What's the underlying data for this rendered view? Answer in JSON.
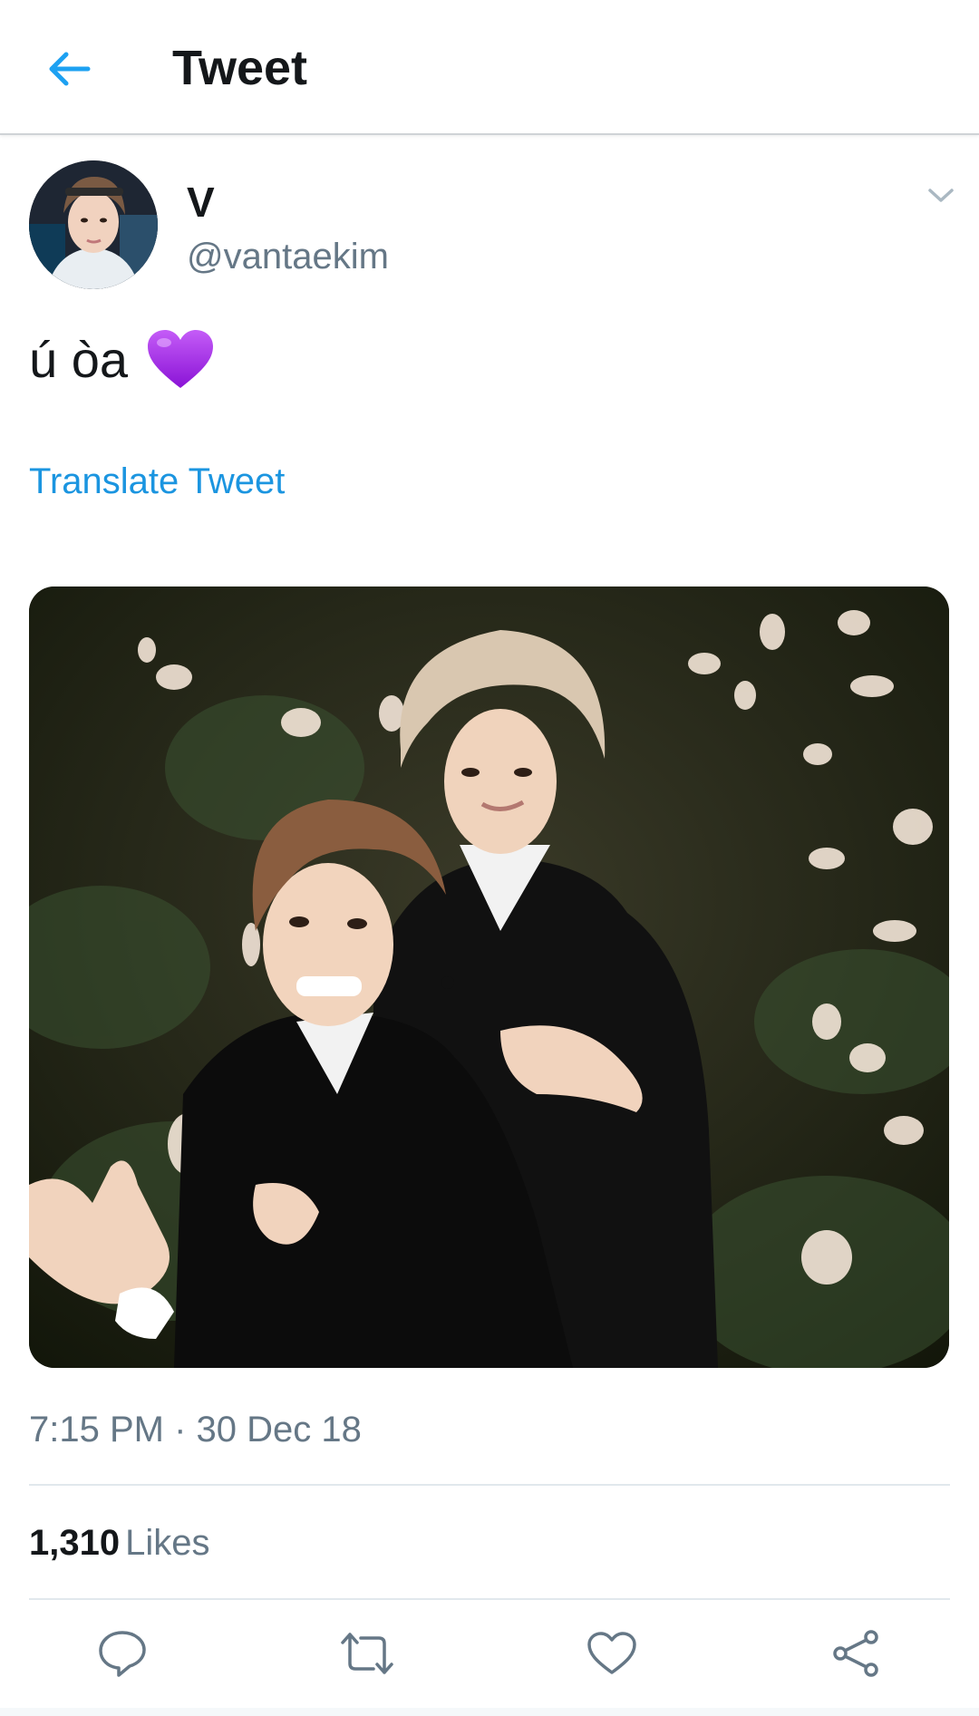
{
  "header": {
    "back_icon": "arrow-left-icon",
    "title": "Tweet"
  },
  "tweet": {
    "author": {
      "display_name": "V",
      "handle": "@vantaekim"
    },
    "text": "ú òa",
    "emoji": "purple-heart",
    "translate_label": "Translate Tweet",
    "timestamp": "7:15 PM · 30 Dec 18",
    "likes": {
      "count": "1,310",
      "label": "Likes"
    }
  },
  "actions": [
    {
      "name": "reply",
      "icon": "reply-icon"
    },
    {
      "name": "retweet",
      "icon": "retweet-icon"
    },
    {
      "name": "like",
      "icon": "heart-icon"
    },
    {
      "name": "share",
      "icon": "share-icon"
    }
  ],
  "colors": {
    "accent": "#1da1f2",
    "link": "#1b95e0",
    "text_primary": "#14171a",
    "text_secondary": "#657786",
    "emoji_heart": "#a020f0"
  }
}
